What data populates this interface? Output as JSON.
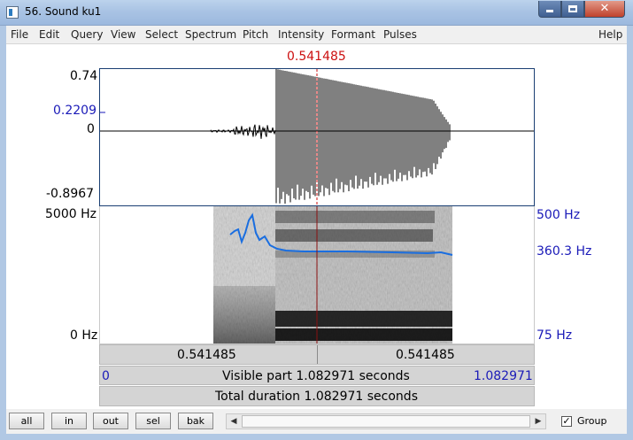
{
  "window": {
    "title": "56. Sound ku1"
  },
  "menu": {
    "items": [
      "File",
      "Edit",
      "Query",
      "View",
      "Select",
      "Spectrum",
      "Pitch",
      "Intensity",
      "Formant",
      "Pulses"
    ],
    "help": "Help"
  },
  "cursor": {
    "time": "0.541485",
    "color": "#cc1010"
  },
  "waveform": {
    "y_max": "0.74",
    "y_marker": "0.2209",
    "y_zero": "0",
    "y_min": "-0.8967"
  },
  "spectrogram": {
    "freq_max": "5000 Hz",
    "freq_min": "0 Hz",
    "pitch_max": "500 Hz",
    "pitch_current": "360.3 Hz",
    "pitch_min": "75 Hz",
    "pitch_color": "#1a6ee0"
  },
  "bars": {
    "left_time": "0.541485",
    "right_time": "0.541485",
    "visible_start": "0",
    "visible_text": "Visible part 1.082971 seconds",
    "visible_end": "1.082971",
    "total_text": "Total duration 1.082971 seconds"
  },
  "toolbar": {
    "buttons": [
      "all",
      "in",
      "out",
      "sel",
      "bak"
    ],
    "group_label": "Group",
    "group_checked": "✓"
  },
  "icons": {
    "window": "window-icon",
    "minimize": "minimize-icon",
    "maximize": "maximize-icon",
    "close": "close-icon",
    "scroll_left": "chevron-left-icon",
    "scroll_right": "chevron-right-icon"
  }
}
